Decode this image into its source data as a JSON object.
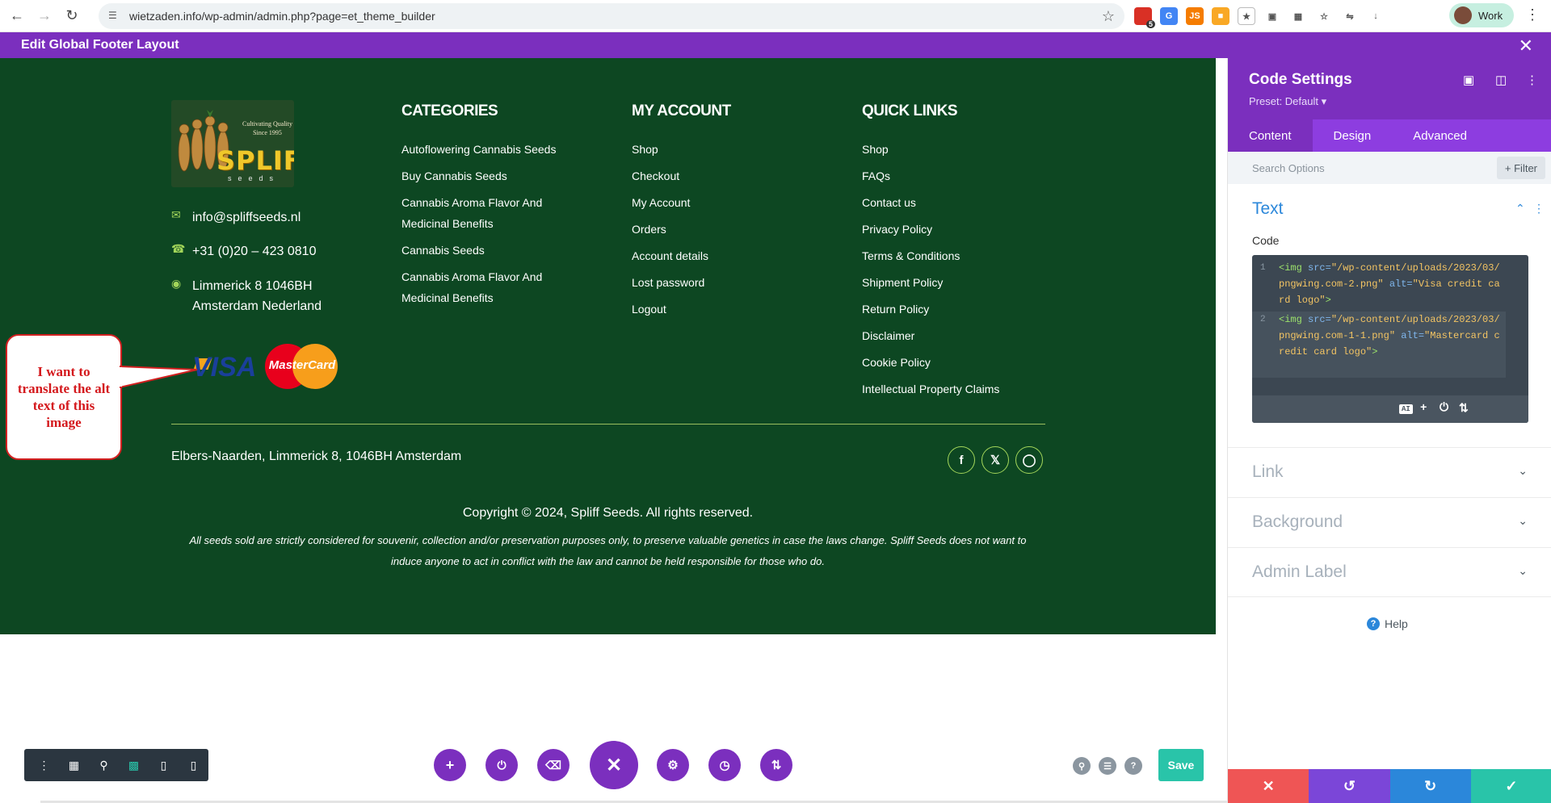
{
  "browser": {
    "url": "wietzaden.info/wp-admin/admin.php?page=et_theme_builder",
    "profile_label": "Work",
    "extension_badge": "5"
  },
  "builder_header": {
    "title": "Edit Global Footer Layout"
  },
  "footer": {
    "logo": {
      "tagline": "Cultivating Quality Since 1995",
      "word": "SPLIFF",
      "sub": "seeds"
    },
    "email": "info@spliffseeds.nl",
    "phone": "+31 (0)20 – 423 0810",
    "address_line1": "Limmerick 8 1046BH",
    "address_line2": "Amsterdam Nederland",
    "card_visa": "VISA",
    "card_mastercard": "MasterCard",
    "columns": [
      {
        "title": "CATEGORIES",
        "links": [
          "Autoflowering Cannabis Seeds",
          "Buy Cannabis Seeds",
          "Cannabis Aroma Flavor And Medicinal Benefits",
          "Cannabis Seeds",
          "Cannabis Aroma Flavor And Medicinal Benefits"
        ]
      },
      {
        "title": "MY ACCOUNT",
        "links": [
          "Shop",
          "Checkout",
          "My Account",
          "Orders",
          "Account details",
          "Lost password",
          "Logout"
        ]
      },
      {
        "title": "QUICK LINKS",
        "links": [
          "Shop",
          "FAQs",
          "Contact us",
          "Privacy Policy",
          "Terms & Conditions",
          "Shipment Policy",
          "Return Policy",
          "Disclaimer",
          "Cookie Policy",
          "Intellectual Property Claims"
        ]
      }
    ],
    "bottom_address": "Elbers-Naarden, Limmerick 8, 1046BH Amsterdam",
    "copyright": "Copyright © 2024, Spliff Seeds. All rights reserved.",
    "disclaimer": "All seeds sold are strictly considered for souvenir, collection and/or preservation purposes only, to preserve valuable genetics in case the laws change. Spliff Seeds does not want to induce anyone to act in conflict with the law and cannot be held responsible for those who do."
  },
  "callout": {
    "text": "I want to translate the alt text of this image"
  },
  "settings": {
    "title": "Code Settings",
    "preset": "Preset: Default ▾",
    "tabs": [
      "Content",
      "Design",
      "Advanced"
    ],
    "active_tab": "Content",
    "search_placeholder": "Search Options",
    "filter_label": "+ Filter",
    "section_text": "Text",
    "code_label": "Code",
    "code_line_numbers": [
      "1",
      "2"
    ],
    "code": {
      "line1": {
        "open": "<img",
        "src_attr": " src=",
        "src_val": "\"/wp-content/uploads/2023/03/pngwing.com-2.png\"",
        "alt_attr": " alt=",
        "alt_val": "\"Visa credit card logo\"",
        "close": ">"
      },
      "line2": {
        "open": "<img",
        "src_attr": " src=",
        "src_val": "\"/wp-content/uploads/2023/03/pngwing.com-1-1.png\"",
        "alt_attr": " alt=",
        "alt_val": "\"Mastercard credit card logo\"",
        "close": ">"
      }
    },
    "ai_badge": "AI",
    "sections": [
      "Link",
      "Background",
      "Admin Label"
    ],
    "help_label": "Help"
  },
  "toolbar": {
    "save_label": "Save"
  },
  "colors": {
    "brand_purple": "#7b2fbe",
    "footer_green": "#0d4722",
    "accent_teal": "#29c4a9",
    "cancel_red": "#ef5555",
    "undo_purple": "#7b46d8",
    "redo_blue": "#2b87da",
    "confirm_green": "#29c4a9"
  }
}
